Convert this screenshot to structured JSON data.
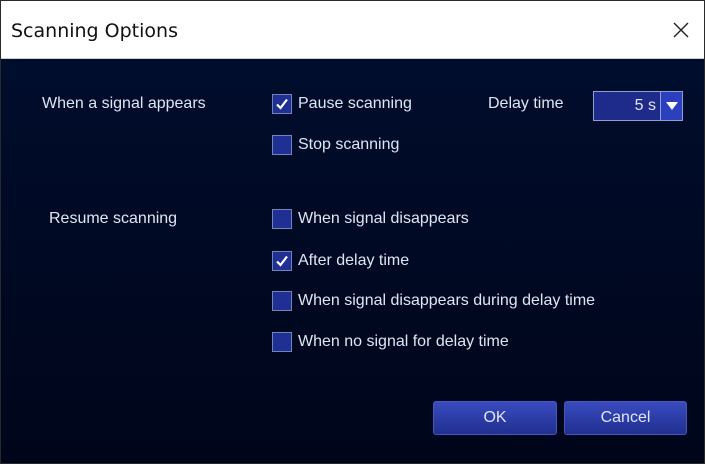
{
  "window": {
    "title": "Scanning Options"
  },
  "signal_appears": {
    "label": "When a signal appears",
    "pause": {
      "label": "Pause scanning",
      "checked": true
    },
    "stop": {
      "label": "Stop scanning",
      "checked": false
    },
    "delay_label": "Delay time",
    "delay_value": "5 s"
  },
  "resume": {
    "label": "Resume scanning",
    "options": [
      {
        "label": "When signal disappears",
        "checked": false
      },
      {
        "label": "After delay time",
        "checked": true
      },
      {
        "label": "When signal disappears during delay time",
        "checked": false
      },
      {
        "label": "When no signal for delay time",
        "checked": false
      }
    ]
  },
  "buttons": {
    "ok": "OK",
    "cancel": "Cancel"
  },
  "colors": {
    "checkbox_fill": "#1f2f93",
    "button_top": "#3a4bc0",
    "button_bottom": "#202f8f"
  }
}
